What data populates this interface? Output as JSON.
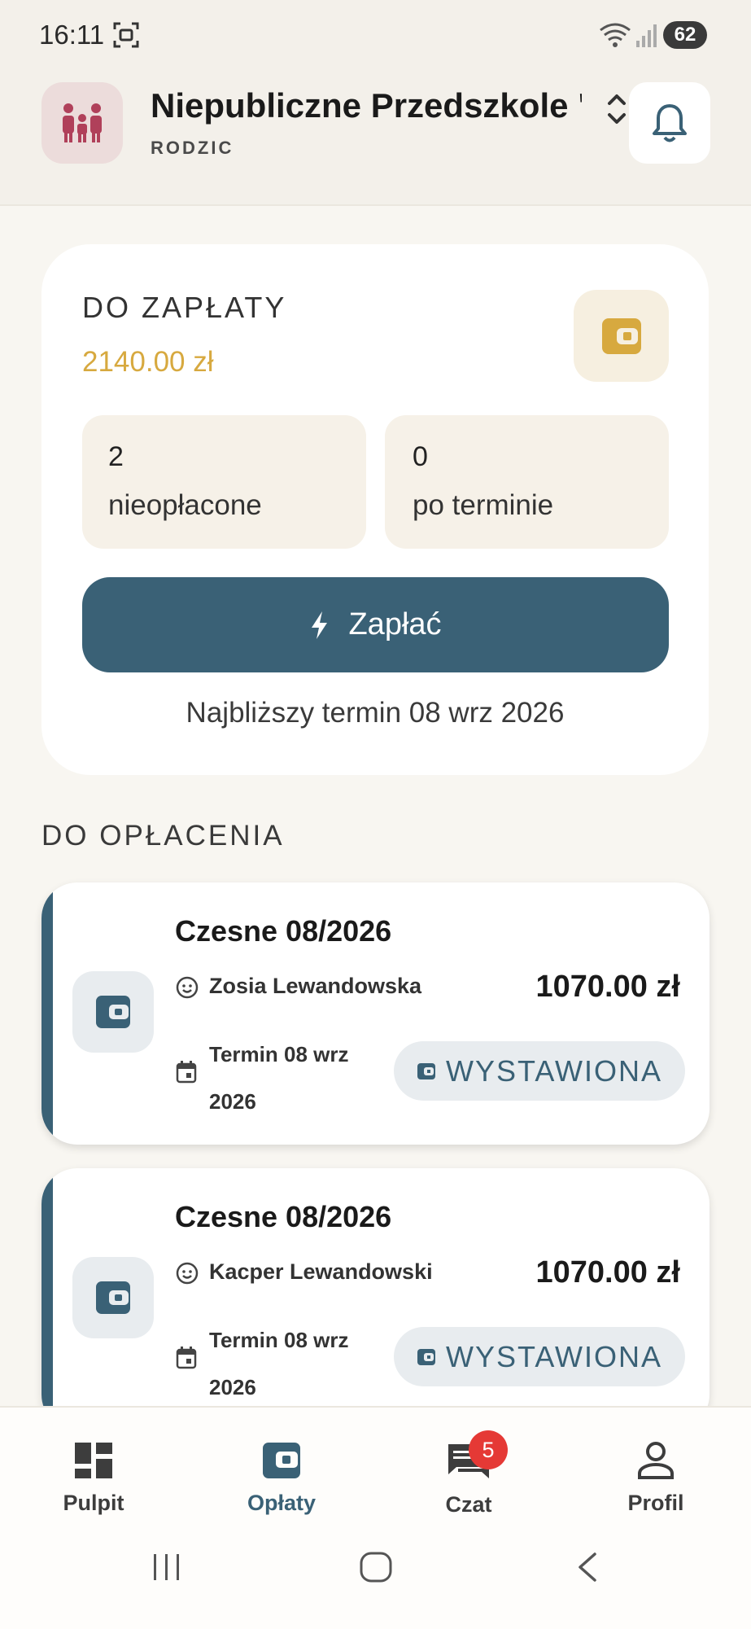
{
  "status_bar": {
    "time": "16:11",
    "battery": "62"
  },
  "header": {
    "org_name": "Niepubliczne Przedszkole \"...",
    "role": "RODZIC"
  },
  "summary": {
    "label": "DO ZAPŁATY",
    "amount": "2140.00 zł",
    "stats": [
      {
        "value": "2",
        "label": "nieopłacone"
      },
      {
        "value": "0",
        "label": "po terminie"
      }
    ],
    "pay_label": "Zapłać",
    "next_due": "Najbliższy termin 08 wrz 2026"
  },
  "section": {
    "title": "DO OPŁACENIA"
  },
  "payments": [
    {
      "title": "Czesne 08/2026",
      "child": "Zosia Lewandowska",
      "amount": "1070.00 zł",
      "term_line1": "Termin 08 wrz",
      "term_line2": "2026",
      "status": "WYSTAWIONA"
    },
    {
      "title": "Czesne 08/2026",
      "child": "Kacper Lewandowski",
      "amount": "1070.00 zł",
      "term_line1": "Termin 08 wrz",
      "term_line2": "2026",
      "status": "WYSTAWIONA"
    }
  ],
  "nav": {
    "items": [
      {
        "label": "Pulpit",
        "icon": "dashboard-icon"
      },
      {
        "label": "Opłaty",
        "icon": "wallet-icon"
      },
      {
        "label": "Czat",
        "icon": "chat-icon"
      },
      {
        "label": "Profil",
        "icon": "person-icon"
      }
    ],
    "active": "Opłaty",
    "chat_badge": "5"
  },
  "colors": {
    "accent": "#3a6176",
    "amount_gold": "#d7a93f",
    "org_avatar": "#b0405a",
    "badge_red": "#e53935",
    "background": "#f8f6f1"
  }
}
